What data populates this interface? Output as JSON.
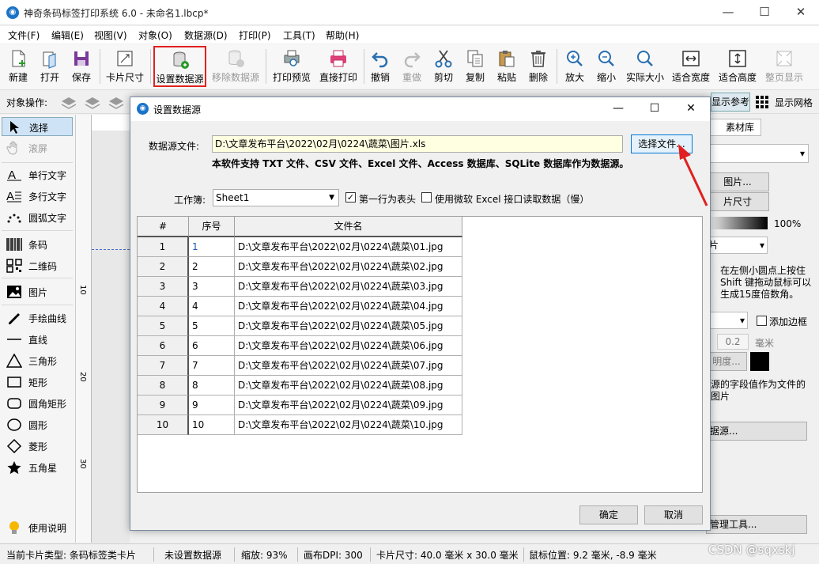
{
  "window": {
    "title": "神奇条码标签打印系统 6.0 - 未命名1.lbcp*"
  },
  "menu": [
    "文件(F)",
    "编辑(E)",
    "视图(V)",
    "对象(O)",
    "数据源(D)",
    "打印(P)",
    "工具(T)",
    "帮助(H)"
  ],
  "toolbar": [
    {
      "label": "新建",
      "icon": "new-file-icon",
      "enabled": true
    },
    {
      "label": "打开",
      "icon": "open-icon",
      "enabled": true
    },
    {
      "label": "保存",
      "icon": "save-icon",
      "enabled": true
    },
    {
      "label": "卡片尺寸",
      "icon": "card-size-icon",
      "enabled": true
    },
    {
      "label": "设置数据源",
      "icon": "database-icon",
      "enabled": true,
      "highlighted": true
    },
    {
      "label": "移除数据源",
      "icon": "database-remove-icon",
      "enabled": false
    },
    {
      "label": "打印预览",
      "icon": "print-preview-icon",
      "enabled": true
    },
    {
      "label": "直接打印",
      "icon": "printer-icon",
      "enabled": true
    },
    {
      "label": "撤销",
      "icon": "undo-icon",
      "enabled": true
    },
    {
      "label": "重做",
      "icon": "redo-icon",
      "enabled": false
    },
    {
      "label": "剪切",
      "icon": "cut-icon",
      "enabled": true
    },
    {
      "label": "复制",
      "icon": "copy-icon",
      "enabled": true
    },
    {
      "label": "粘贴",
      "icon": "paste-icon",
      "enabled": true
    },
    {
      "label": "删除",
      "icon": "delete-icon",
      "enabled": true
    },
    {
      "label": "放大",
      "icon": "zoom-in-icon",
      "enabled": true
    },
    {
      "label": "缩小",
      "icon": "zoom-out-icon",
      "enabled": true
    },
    {
      "label": "实际大小",
      "icon": "actual-size-icon",
      "enabled": true
    },
    {
      "label": "适合宽度",
      "icon": "fit-width-icon",
      "enabled": true
    },
    {
      "label": "适合高度",
      "icon": "fit-height-icon",
      "enabled": true
    },
    {
      "label": "整页显示",
      "icon": "full-page-icon",
      "enabled": false
    }
  ],
  "object_ops": {
    "label": "对象操作:",
    "ref_lines": "显示参考线",
    "grid": "显示网格"
  },
  "tools": [
    {
      "label": "选择",
      "icon": "cursor-icon",
      "active": true
    },
    {
      "label": "滚屏",
      "icon": "hand-icon",
      "disabled": true
    },
    {
      "label": "单行文字",
      "icon": "single-text-icon"
    },
    {
      "label": "多行文字",
      "icon": "multi-text-icon"
    },
    {
      "label": "圆弧文字",
      "icon": "arc-text-icon"
    },
    {
      "label": "条码",
      "icon": "barcode-icon"
    },
    {
      "label": "二维码",
      "icon": "qrcode-icon"
    },
    {
      "label": "图片",
      "icon": "image-icon"
    },
    {
      "label": "手绘曲线",
      "icon": "pen-icon"
    },
    {
      "label": "直线",
      "icon": "line-icon"
    },
    {
      "label": "三角形",
      "icon": "triangle-icon"
    },
    {
      "label": "矩形",
      "icon": "rectangle-icon"
    },
    {
      "label": "圆角矩形",
      "icon": "rounded-rect-icon"
    },
    {
      "label": "圆形",
      "icon": "circle-icon"
    },
    {
      "label": "菱形",
      "icon": "diamond-icon"
    },
    {
      "label": "五角星",
      "icon": "star-icon"
    }
  ],
  "help_label": "使用说明",
  "ruler": [
    "10",
    "20",
    "30"
  ],
  "right_panel": {
    "tab": "素材库",
    "btn_image": "图片...",
    "btn_size": "片尺寸",
    "percent": "100%",
    "combo2": "片",
    "hint": "在左侧小圆点上按住 Shift 键拖动鼠标可以生成15度倍数角。",
    "add_border": "添加边框",
    "border_value": "0.2",
    "unit": "毫米",
    "opacity_btn": "明度...",
    "field_hint": "源的字段值作为文件的图片",
    "datasource_btn": "据源...",
    "manage_btn": "管理工具..."
  },
  "dialog": {
    "title": "设置数据源",
    "file_label": "数据源文件:",
    "file_path": "D:\\文章发布平台\\2022\\02月\\0224\\蔬菜\\图片.xls",
    "choose_btn": "选择文件...",
    "support_note": "本软件支持 TXT 文件、CSV 文件、Excel 文件、Access 数据库、SQLite 数据库作为数据源。",
    "workbook_label": "工作簿:",
    "workbook_value": "Sheet1",
    "first_row_header": "第一行为表头",
    "first_row_checked": true,
    "ms_interface": "使用微软 Excel 接口读取数据（慢）",
    "ms_checked": false,
    "columns": [
      "#",
      "序号",
      "文件名"
    ],
    "rows": [
      [
        "1",
        "1",
        "D:\\文章发布平台\\2022\\02月\\0224\\蔬菜\\01.jpg"
      ],
      [
        "2",
        "2",
        "D:\\文章发布平台\\2022\\02月\\0224\\蔬菜\\02.jpg"
      ],
      [
        "3",
        "3",
        "D:\\文章发布平台\\2022\\02月\\0224\\蔬菜\\03.jpg"
      ],
      [
        "4",
        "4",
        "D:\\文章发布平台\\2022\\02月\\0224\\蔬菜\\04.jpg"
      ],
      [
        "5",
        "5",
        "D:\\文章发布平台\\2022\\02月\\0224\\蔬菜\\05.jpg"
      ],
      [
        "6",
        "6",
        "D:\\文章发布平台\\2022\\02月\\0224\\蔬菜\\06.jpg"
      ],
      [
        "7",
        "7",
        "D:\\文章发布平台\\2022\\02月\\0224\\蔬菜\\07.jpg"
      ],
      [
        "8",
        "8",
        "D:\\文章发布平台\\2022\\02月\\0224\\蔬菜\\08.jpg"
      ],
      [
        "9",
        "9",
        "D:\\文章发布平台\\2022\\02月\\0224\\蔬菜\\09.jpg"
      ],
      [
        "10",
        "10",
        "D:\\文章发布平台\\2022\\02月\\0224\\蔬菜\\10.jpg"
      ]
    ],
    "ok": "确定",
    "cancel": "取消"
  },
  "status": {
    "card_type": "当前卡片类型: 条码标签类卡片",
    "datasource": "未设置数据源",
    "zoom": "缩放: 93%",
    "dpi": "画布DPI: 300",
    "card_size": "卡片尺寸: 40.0 毫米 x 30.0 毫米",
    "mouse_pos": "鼠标位置: 9.2 毫米, -8.9 毫米"
  },
  "watermark": "CSDN @sqxskj",
  "colors": {
    "accent": "#1a73c8",
    "highlight_box": "#e02020",
    "arrow": "#e02020"
  }
}
